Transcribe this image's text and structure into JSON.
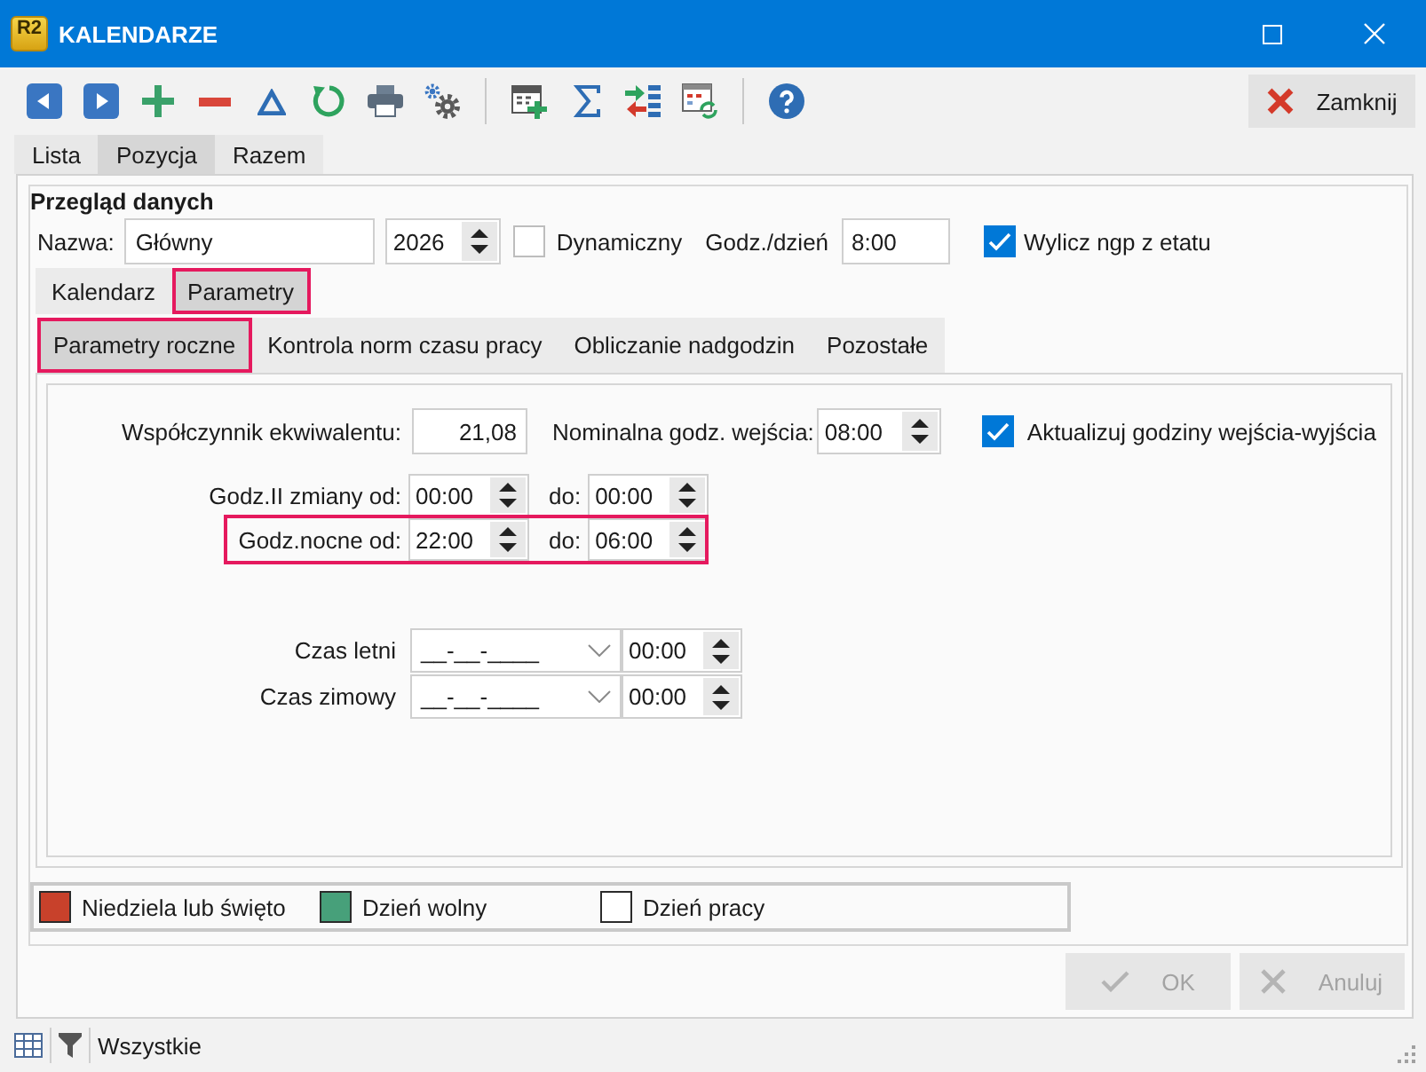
{
  "window": {
    "title": "KALENDARZE",
    "logo_text": "R2"
  },
  "toolbar": {
    "close_button": "Zamknij"
  },
  "main_tabs": [
    {
      "label": "Lista",
      "selected": false
    },
    {
      "label": "Pozycja",
      "selected": true
    },
    {
      "label": "Razem",
      "selected": false
    }
  ],
  "section_title": "Przegląd danych",
  "header": {
    "name_label": "Nazwa:",
    "name": "Główny",
    "year": "2026",
    "dynamic": {
      "label": "Dynamiczny",
      "checked": false
    },
    "hours_label": "Godz./dzień",
    "hours": "8:00",
    "compute_ngp": {
      "label": "Wylicz ngp z etatu",
      "checked": true
    }
  },
  "tabs": [
    {
      "label": "Kalendarz",
      "selected": false,
      "highlighted": false
    },
    {
      "label": "Parametry",
      "selected": true,
      "highlighted": true
    }
  ],
  "subtabs": [
    {
      "label": "Parametry roczne",
      "selected": true,
      "highlighted": true
    },
    {
      "label": "Kontrola norm czasu pracy",
      "selected": false,
      "highlighted": false
    },
    {
      "label": "Obliczanie nadgodzin",
      "selected": false,
      "highlighted": false
    },
    {
      "label": "Pozostałe",
      "selected": false,
      "highlighted": false
    }
  ],
  "params": {
    "equivalent": {
      "label": "Współczynnik ekwiwalentu:",
      "value": "21,08"
    },
    "nominal": {
      "label": "Nominalna godz. wejścia:",
      "value": "08:00"
    },
    "update_hours": {
      "label": "Aktualizuj godziny wejścia-wyjścia",
      "checked": true
    },
    "shift_rows": [
      {
        "label": "Godz.II zmiany od:",
        "from": "00:00",
        "to_label": "do:",
        "to": "00:00",
        "highlighted": false
      },
      {
        "label": "Godz.nocne od:",
        "from": "22:00",
        "to_label": "do:",
        "to": "06:00",
        "highlighted": true
      }
    ],
    "time_change_rows": [
      {
        "label": "Czas letni",
        "date": "__-__-____",
        "time": "00:00"
      },
      {
        "label": "Czas zimowy",
        "date": "__-__-____",
        "time": "00:00"
      }
    ]
  },
  "legend": [
    {
      "label": "Niedziela lub święto",
      "color": "#c8412b"
    },
    {
      "label": "Dzień wolny",
      "color": "#47a07a"
    },
    {
      "label": "Dzień pracy",
      "color": "#ffffff"
    }
  ],
  "buttons": [
    {
      "kind": "ok",
      "label": "OK",
      "disabled": true
    },
    {
      "kind": "cancel",
      "label": "Anuluj",
      "disabled": true
    }
  ],
  "status_bar": {
    "filter": "Wszystkie"
  }
}
